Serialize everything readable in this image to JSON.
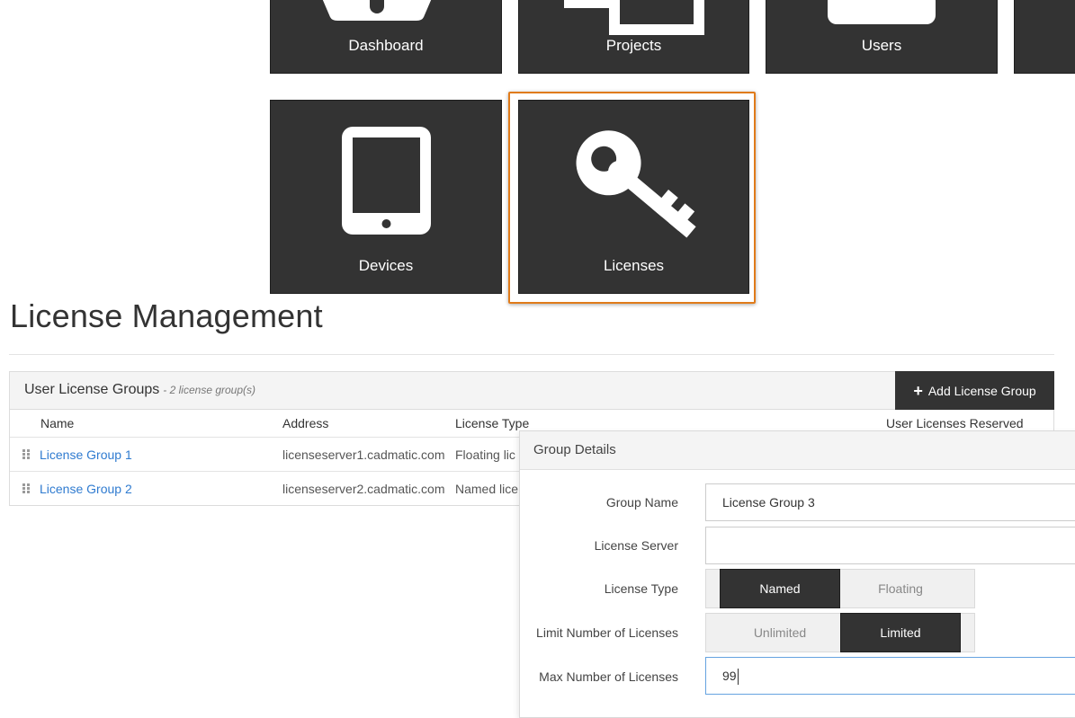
{
  "tiles": {
    "dashboard": "Dashboard",
    "projects": "Projects",
    "users": "Users",
    "devices": "Devices",
    "licenses": "Licenses"
  },
  "page": {
    "title": "License Management"
  },
  "license_groups": {
    "title": "User License Groups",
    "count_text": "- 2 license group(s)",
    "add_button": "Add License Group",
    "columns": [
      "Name",
      "Address",
      "License Type",
      "User Licenses Reserved"
    ],
    "rows": [
      {
        "name": "License Group 1",
        "address": "licenseserver1.cadmatic.com",
        "type": "Floating lic"
      },
      {
        "name": "License Group 2",
        "address": "licenseserver2.cadmatic.com",
        "type": "Named lice"
      }
    ]
  },
  "group_details": {
    "title": "Group Details",
    "group_name_label": "Group Name",
    "group_name_value": "License Group 3",
    "license_server_label": "License Server",
    "license_server_value": "",
    "license_type_label": "License Type",
    "license_type_options": [
      "Named",
      "Floating"
    ],
    "license_type_selected": "Named",
    "limit_label": "Limit Number of Licenses",
    "limit_options": [
      "Unlimited",
      "Limited"
    ],
    "limit_selected": "Limited",
    "max_label": "Max Number of Licenses",
    "max_value": "99"
  },
  "colors": {
    "tile": "#333333",
    "highlight": "#e07b1a",
    "link": "#2f7bd0"
  }
}
